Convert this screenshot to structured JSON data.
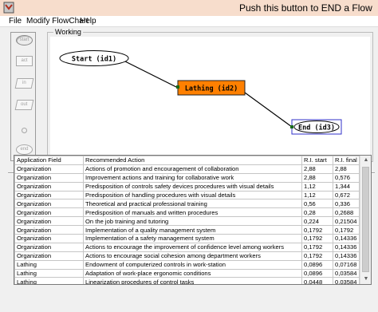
{
  "window": {
    "title": "Push this button to END a Flow"
  },
  "menu": [
    "File",
    "Modify FlowChart",
    "Help"
  ],
  "toolbar": {
    "buttons": [
      {
        "label": "start",
        "icon": "start-tool-icon"
      },
      {
        "label": "act",
        "icon": "activity-tool-icon"
      },
      {
        "label": "in",
        "icon": "input-tool-icon"
      },
      {
        "label": "out",
        "icon": "output-tool-icon"
      },
      {
        "label": "",
        "icon": "connector-circle-icon"
      },
      {
        "label": "end",
        "icon": "end-tool-icon"
      }
    ]
  },
  "working": {
    "label": "Working",
    "nodes": {
      "start": "Start (id1)",
      "lathing": "Lathing (id2)",
      "end": "End (id3)"
    },
    "colors": {
      "activity_fill": "#ff8000",
      "selection_border": "#3030c8",
      "connector_dot": "#1a6b1a"
    }
  },
  "table": {
    "headers": [
      "Application Field",
      "Recommended Action",
      "R.I. start",
      "R.I. final"
    ],
    "rows": [
      [
        "Organization",
        "Actions of promotion and encouragement of collaboration",
        "2,88",
        "2,88"
      ],
      [
        "Organization",
        "Improvement actions and training for collaborative work",
        "2,88",
        "0,576"
      ],
      [
        "Organization",
        "Predisposition of controls safety devices procedures with visual details",
        "1,12",
        "1,344"
      ],
      [
        "Organization",
        "Predisposition of handling procedures with visual details",
        "1,12",
        "0,672"
      ],
      [
        "Organization",
        "Theoretical and practical professional training",
        "0,56",
        "0,336"
      ],
      [
        "Organization",
        "Predisposition of manuals and written procedures",
        "0,28",
        "0,2688"
      ],
      [
        "Organization",
        "On the job training and tutoring",
        "0,224",
        "0,21504"
      ],
      [
        "Organization",
        "Implementation of a quality management system",
        "0,1792",
        "0,1792"
      ],
      [
        "Organization",
        "Implementation of a safety management system",
        "0,1792",
        "0,14336"
      ],
      [
        "Organization",
        "Actions to encourage the improvement of confidence level among workers",
        "0,1792",
        "0,14336"
      ],
      [
        "Organization",
        "Actions to encourage social cohesion among department workers",
        "0,1792",
        "0,14336"
      ],
      [
        "Lathing",
        "Endowment of computerized controls in work-station",
        "0,0896",
        "0,07168"
      ],
      [
        "Lathing",
        "Adaptation of work-place ergonomic conditions",
        "0,0896",
        "0,03584"
      ],
      [
        "Lathing",
        "Linearization procedures of control tasks",
        "0,0448",
        "0,03584"
      ]
    ]
  }
}
